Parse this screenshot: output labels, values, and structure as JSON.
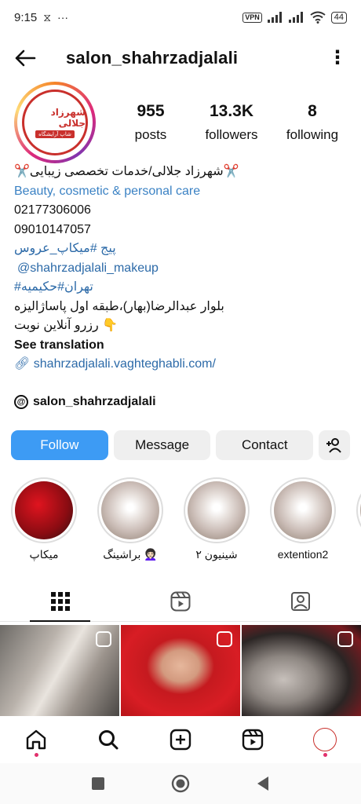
{
  "status_bar": {
    "time": "9:15",
    "vpn": "VPN",
    "battery": "44"
  },
  "header": {
    "username": "salon_shahrzadjalali"
  },
  "profile": {
    "logo_text": "شهرزاد جلالی",
    "logo_subtext": "شاپ آرایشگاه",
    "stats": [
      {
        "value": "955",
        "label": "posts"
      },
      {
        "value": "13.3K",
        "label": "followers"
      },
      {
        "value": "8",
        "label": "following"
      }
    ]
  },
  "bio": {
    "name_line": "✂️شهرزاد جلالی/خدمات تخصصی زیبایی✂️",
    "category": "Beauty, cosmetic & personal care",
    "phone1": "02177306006",
    "phone2": "09010147057",
    "page_line": "پیج #میکاپ_عروس",
    "mention": "@shahrzadjalali_makeup",
    "hashtags": "تهران#حکیمیه#",
    "address": "بلوار عبدالرضا(بهار)،طبقه اول پاساژالیزه",
    "booking": "👇 رزرو آنلاین نوبت",
    "see_translation": "See translation",
    "website": "shahrzadjalali.vaghteghabli.com/",
    "threads_handle": "salon_shahrzadjalali"
  },
  "actions": {
    "follow": "Follow",
    "message": "Message",
    "contact": "Contact"
  },
  "highlights": [
    {
      "label": "میکاپ",
      "style": "red"
    },
    {
      "label": "براشینگ 👩🏻‍🦱",
      "style": "flower"
    },
    {
      "label": "شینیون ۲",
      "style": "flower"
    },
    {
      "label": "extention2",
      "style": "flower"
    },
    {
      "label": "",
      "style": "flower"
    }
  ],
  "tabs": [
    "grid-icon",
    "reels-icon",
    "tagged-icon"
  ],
  "colors": {
    "follow_blue": "#3d9bf4",
    "link_blue": "#2c6aa8",
    "category_blue": "#3b82c4",
    "brand_red": "#c9302c"
  }
}
